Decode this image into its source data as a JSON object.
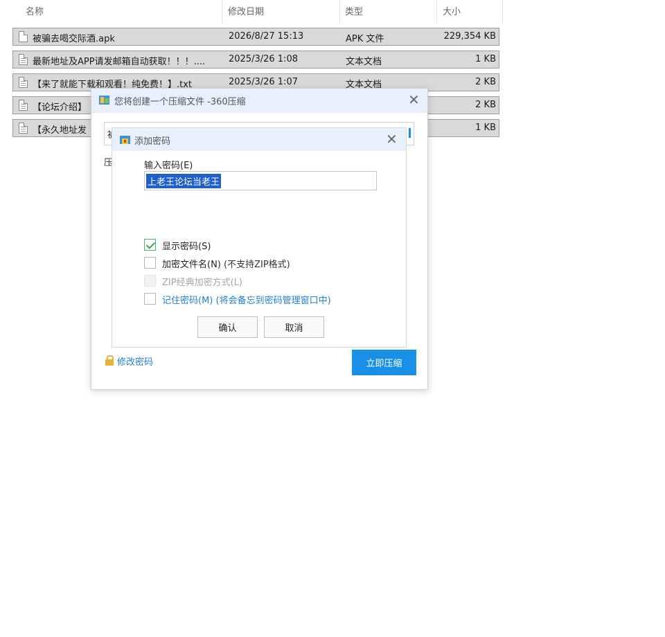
{
  "explorer": {
    "columns": {
      "name": "名称",
      "date": "修改日期",
      "type": "类型",
      "size": "大小"
    },
    "files": [
      {
        "name": "被骗去喝交际酒.apk",
        "date": "2026/8/27 15:13",
        "type": "APK 文件",
        "size": "229,354 KB",
        "icon": "file-icon"
      },
      {
        "name": "最新地址及APP请发邮箱自动获取！！！....",
        "date": "2025/3/26 1:08",
        "type": "文本文档",
        "size": "1 KB",
        "icon": "text-file-icon"
      },
      {
        "name": "【来了就能下载和观看！纯免费！】.txt",
        "date": "2025/3/26 1:07",
        "type": "文本文档",
        "size": "2 KB",
        "icon": "text-file-icon"
      },
      {
        "name": "【论坛介绍】",
        "date": "",
        "type": "",
        "size": "2 KB",
        "icon": "text-file-icon"
      },
      {
        "name": "【永久地址发",
        "date": "",
        "type": "",
        "size": "1 KB",
        "icon": "text-file-icon"
      }
    ]
  },
  "compress_dialog": {
    "title": "您将创建一个压缩文件 -360压缩",
    "peek_input_char": "被",
    "peek_label": "压",
    "modify_password": "修改密码",
    "compress_now": "立即压缩"
  },
  "password_dialog": {
    "title": "添加密码",
    "input_label": "输入密码(E)",
    "password_value": "上老王论坛当老王",
    "options": {
      "show_password": {
        "label": "显示密码(S)",
        "checked": true
      },
      "encrypt_filename": {
        "label": "加密文件名(N)",
        "hint": "(不支持ZIP格式)",
        "checked": false
      },
      "zip_classic": {
        "label": "ZIP经典加密方式(L)",
        "enabled": false
      },
      "remember": {
        "label": "记住密码(M) (将会备忘到密码管理窗口中)",
        "checked": false
      }
    },
    "ok": "确认",
    "cancel": "取消"
  },
  "colors": {
    "accent": "#1a8fe8",
    "title_bar": "#e7f0fb",
    "selection": "#1e5fc9",
    "row_selected": "#d9d9d9"
  }
}
